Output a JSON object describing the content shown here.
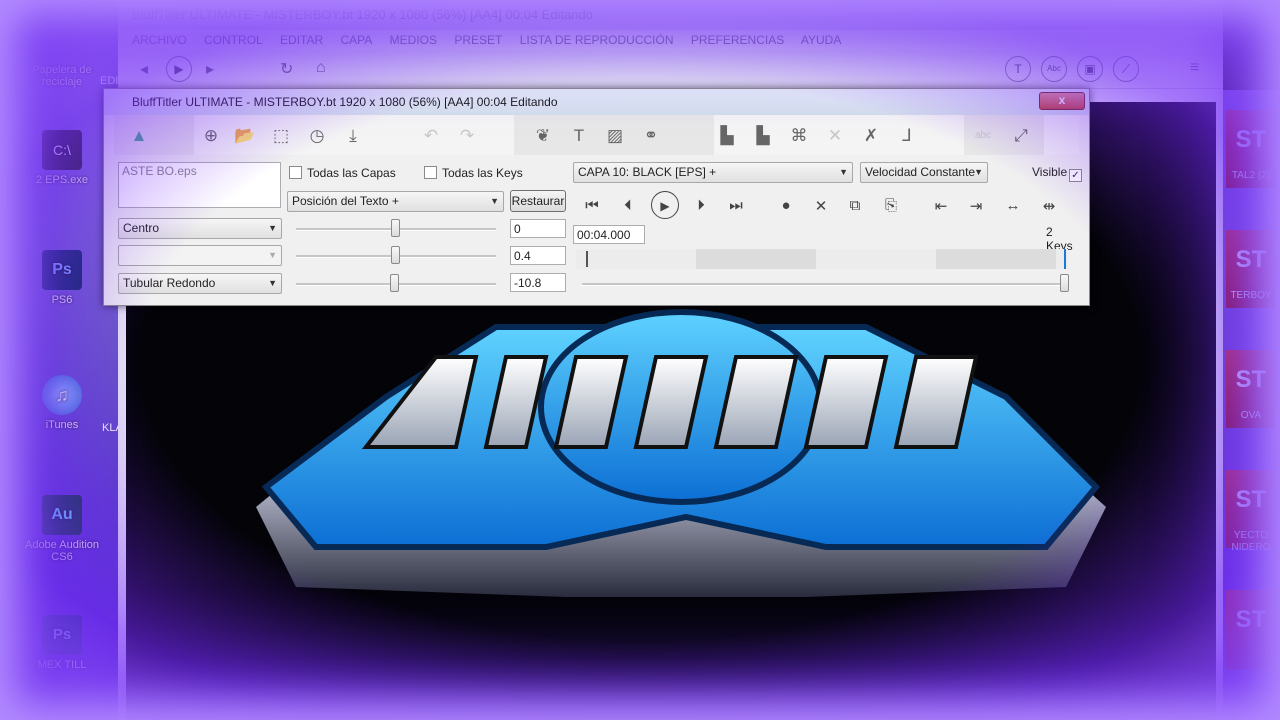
{
  "desktop": {
    "icons": [
      {
        "label": "Papelera de reciclaje",
        "icon": "recycle-bin-icon"
      },
      {
        "label": "2 EPS.exe",
        "icon": "exe-icon"
      },
      {
        "label": "PS6",
        "icon": "photoshop-icon"
      },
      {
        "label": "iTunes",
        "icon": "itunes-icon"
      },
      {
        "label": "Adobe Audition CS6",
        "icon": "audition-icon"
      },
      {
        "label": "MEX TILL",
        "icon": "psd-icon"
      }
    ],
    "right_labels": [
      "TAL2 (2)",
      "TERBOY",
      "OVA",
      "YECTO NIDERO"
    ],
    "left_clip": [
      "EDI",
      "KLA"
    ]
  },
  "main_window": {
    "title": "BluffTitler ULTIMATE  - MISTERBOY.bt 1920 x 1080 (56%) [AA4] 00:04 Editando",
    "menu": [
      "ARCHIVO",
      "CONTROL",
      "EDITAR",
      "CAPA",
      "MEDIOS",
      "PRESET",
      "LISTA DE REPRODUCCIÓN",
      "PREFERENCIAS",
      "AYUDA"
    ]
  },
  "dialog": {
    "title": "BluffTitler ULTIMATE  - MISTERBOY.bt 1920 x 1080 (56%) [AA4] 00:04 Editando",
    "close_label": "x",
    "layer_file": "ASTE BO.eps",
    "all_layers_label": "Todas las Capas",
    "all_keys_label": "Todas las Keys",
    "property_combo": "Posición del Texto +",
    "restore_label": "Restaurar",
    "layer_combo": "CAPA     10: BLACK [EPS] +",
    "speed_combo": "Velocidad Constante",
    "visible_label": "Visible",
    "visible_checked": "✓",
    "row1_combo": "Centro",
    "row2_combo": "",
    "row3_combo": "Tubular Redondo",
    "value1": "0",
    "value2": "0.4",
    "value3": "-10.8",
    "time_value": "00:04.000",
    "keys_label": "2 Keys"
  }
}
